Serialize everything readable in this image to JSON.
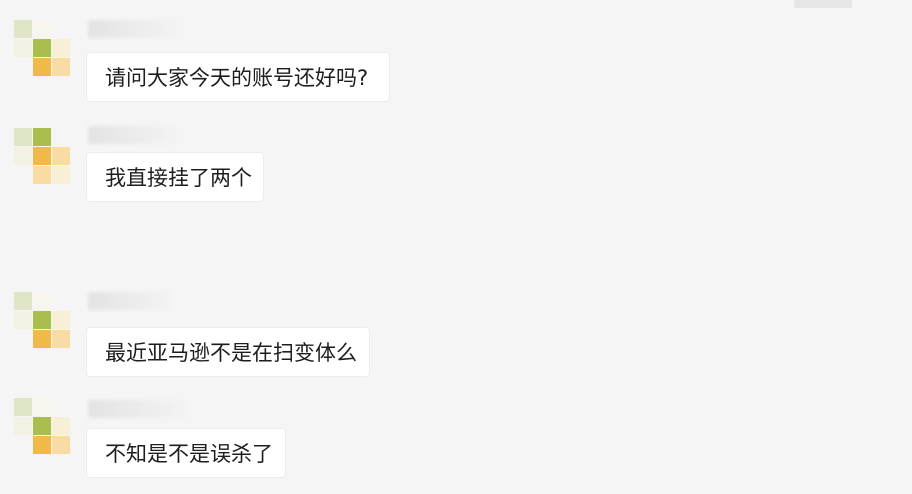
{
  "messages": [
    {
      "text": "请问大家今天的账号还好吗?"
    },
    {
      "text": "我直接挂了两个"
    },
    {
      "text": "最近亚马逊不是在扫变体么"
    },
    {
      "text": "不知是不是误杀了"
    }
  ],
  "colors": {
    "background": "#f5f5f5",
    "bubble": "#ffffff",
    "text": "#1e1e1e",
    "avatar_olive": "#a9bf4d",
    "avatar_orange": "#f1b84a",
    "avatar_light_orange": "#f9dca4",
    "avatar_pale": "#f7efd6",
    "avatar_light_green": "#dfe6c7"
  },
  "icons": [
    "avatar-pixelated",
    "name-pixelated"
  ]
}
